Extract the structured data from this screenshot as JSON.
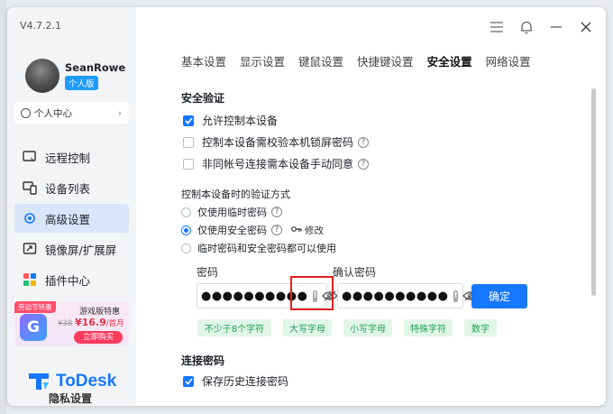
{
  "app": {
    "version": "V4.7.2.1",
    "brand": "ToDesk",
    "accent_color": "#1677ff"
  },
  "user": {
    "name": "SeanRowe",
    "badge": "个人版",
    "personal_center": "个人中心"
  },
  "sidebar": {
    "items": [
      {
        "label": "远程控制",
        "icon": "remote-control-icon",
        "active": false
      },
      {
        "label": "设备列表",
        "icon": "device-list-icon",
        "active": false
      },
      {
        "label": "高级设置",
        "icon": "advanced-settings-icon",
        "active": true
      },
      {
        "label": "镜像屏/扩展屏",
        "icon": "mirror-screen-icon",
        "active": false
      },
      {
        "label": "插件中心",
        "icon": "plugin-center-icon",
        "active": false
      }
    ],
    "hidden_item": "隐私设置"
  },
  "promo": {
    "tag": "劳动节特惠",
    "title": "游戏版特惠",
    "old_price": "¥38",
    "price": "¥16.9",
    "unit": "/首月",
    "button": "立即购买"
  },
  "tabs": [
    {
      "label": "基本设置",
      "active": false
    },
    {
      "label": "显示设置",
      "active": false
    },
    {
      "label": "键鼠设置",
      "active": false
    },
    {
      "label": "快捷键设置",
      "active": false
    },
    {
      "label": "安全设置",
      "active": true
    },
    {
      "label": "网络设置",
      "active": false
    }
  ],
  "security": {
    "title": "安全验证",
    "options": [
      {
        "label": "允许控制本设备",
        "checked": true,
        "help": false
      },
      {
        "label": "控制本设备需校验本机锁屏密码",
        "checked": false,
        "help": true
      },
      {
        "label": "非同帐号连接需本设备手动同意",
        "checked": false,
        "help": true
      }
    ],
    "method_title": "控制本设备时的验证方式",
    "methods": [
      {
        "label": "仅使用临时密码",
        "selected": false,
        "help": true
      },
      {
        "label": "仅使用安全密码",
        "selected": true,
        "help": true,
        "modify": "修改"
      },
      {
        "label": "临时密码和安全密码都可以使用",
        "selected": false,
        "help": false
      }
    ],
    "password_label": "密码",
    "password_value": "●●●●●●●●●●",
    "confirm_label": "确认密码",
    "confirm_value": "●●●●●●●●●●",
    "confirm_button": "确定",
    "rules": [
      "不少于8个字符",
      "大写字母",
      "小写字母",
      "特殊字符",
      "数字"
    ]
  },
  "connection": {
    "title": "连接密码",
    "save_history": "保存历史连接密码",
    "save_history_checked": true
  }
}
